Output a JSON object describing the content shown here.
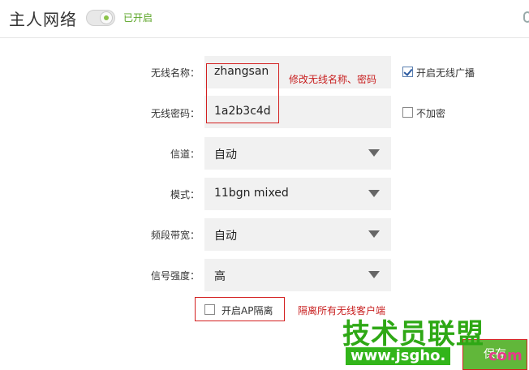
{
  "header": {
    "title": "主人网络",
    "toggle_status": "已开启",
    "toggle_on": true
  },
  "form": {
    "ssid": {
      "label": "无线名称：",
      "value": "zhangsan"
    },
    "password": {
      "label": "无线密码：",
      "value": "1a2b3c4d"
    },
    "channel": {
      "label": "信道：",
      "value": "自动"
    },
    "mode": {
      "label": "模式：",
      "value": "11bgn mixed"
    },
    "bandwidth": {
      "label": "频段带宽：",
      "value": "自动"
    },
    "signal": {
      "label": "信号强度：",
      "value": "高"
    }
  },
  "options": {
    "broadcast": {
      "label": "开启无线广播",
      "checked": true
    },
    "no_encrypt": {
      "label": "不加密",
      "checked": false
    },
    "ap_isolation": {
      "label": "开启AP隔离",
      "checked": false
    }
  },
  "annotations": {
    "ssid_note": "修改无线名称、密码",
    "ap_note": "隔离所有无线客户端"
  },
  "actions": {
    "save_label": "保存"
  },
  "watermark": {
    "title": "技术员联盟",
    "url": "www.jsgho.",
    "url_tail": "com"
  },
  "colors": {
    "accent_green": "#61b73a",
    "annotation_red": "#d32020",
    "field_bg": "#f1f1f1"
  }
}
